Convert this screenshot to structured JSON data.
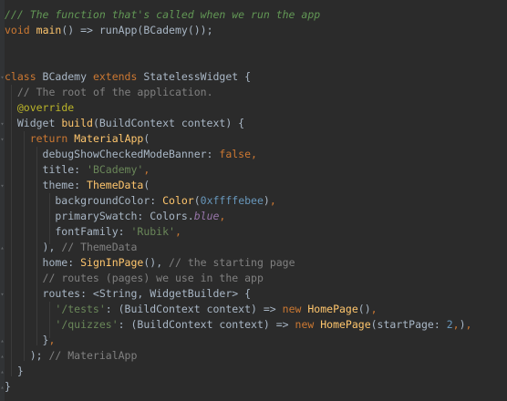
{
  "editor": {
    "lines": [
      {
        "tokens": [
          {
            "t": "/// The function that's called when we run the app",
            "c": "c"
          }
        ]
      },
      {
        "tokens": [
          {
            "t": "void",
            "c": "k"
          },
          {
            "t": " ",
            "c": "p"
          },
          {
            "t": "main",
            "c": "fn"
          },
          {
            "t": "() => runApp(BCademy());",
            "c": "p"
          }
        ]
      },
      {
        "tokens": []
      },
      {
        "tokens": []
      },
      {
        "tokens": [
          {
            "t": "class",
            "c": "k"
          },
          {
            "t": " BCademy ",
            "c": "p"
          },
          {
            "t": "extends",
            "c": "k"
          },
          {
            "t": " StatelessWidget {",
            "c": "p"
          }
        ]
      },
      {
        "tokens": [
          {
            "t": "  ",
            "c": "p"
          },
          {
            "t": "// The root of the application.",
            "c": "cm"
          }
        ]
      },
      {
        "tokens": [
          {
            "t": "  ",
            "c": "p"
          },
          {
            "t": "@override",
            "c": "an"
          }
        ]
      },
      {
        "tokens": [
          {
            "t": "  Widget ",
            "c": "p"
          },
          {
            "t": "build",
            "c": "fn"
          },
          {
            "t": "(BuildContext context) {",
            "c": "p"
          }
        ]
      },
      {
        "tokens": [
          {
            "t": "    ",
            "c": "p"
          },
          {
            "t": "return",
            "c": "k"
          },
          {
            "t": " ",
            "c": "p"
          },
          {
            "t": "MaterialApp",
            "c": "fn"
          },
          {
            "t": "(",
            "c": "p"
          }
        ]
      },
      {
        "tokens": [
          {
            "t": "      debugShowCheckedModeBanner: ",
            "c": "p"
          },
          {
            "t": "false",
            "c": "k"
          },
          {
            "t": ",",
            "c": "k"
          }
        ]
      },
      {
        "tokens": [
          {
            "t": "      title: ",
            "c": "p"
          },
          {
            "t": "'BCademy'",
            "c": "s"
          },
          {
            "t": ",",
            "c": "k"
          }
        ]
      },
      {
        "tokens": [
          {
            "t": "      theme: ",
            "c": "p"
          },
          {
            "t": "ThemeData",
            "c": "fn"
          },
          {
            "t": "(",
            "c": "p"
          }
        ]
      },
      {
        "tokens": [
          {
            "t": "        backgroundColor: ",
            "c": "p"
          },
          {
            "t": "Color",
            "c": "fn"
          },
          {
            "t": "(",
            "c": "p"
          },
          {
            "t": "0xffffebee",
            "c": "n"
          },
          {
            "t": ")",
            "c": "p"
          },
          {
            "t": ",",
            "c": "k"
          }
        ]
      },
      {
        "tokens": [
          {
            "t": "        primarySwatch: Colors.",
            "c": "p"
          },
          {
            "t": "blue",
            "c": "it"
          },
          {
            "t": ",",
            "c": "k"
          }
        ]
      },
      {
        "tokens": [
          {
            "t": "        fontFamily: ",
            "c": "p"
          },
          {
            "t": "'Rubik'",
            "c": "s"
          },
          {
            "t": ",",
            "c": "k"
          }
        ]
      },
      {
        "tokens": [
          {
            "t": "      ), ",
            "c": "p"
          },
          {
            "t": "// ThemeData",
            "c": "cm"
          }
        ]
      },
      {
        "tokens": [
          {
            "t": "      home: ",
            "c": "p"
          },
          {
            "t": "SignInPage",
            "c": "fn"
          },
          {
            "t": "(), ",
            "c": "p"
          },
          {
            "t": "// the starting page",
            "c": "cm"
          }
        ]
      },
      {
        "tokens": [
          {
            "t": "      ",
            "c": "p"
          },
          {
            "t": "// routes (pages) we use in the app",
            "c": "cm"
          }
        ]
      },
      {
        "tokens": [
          {
            "t": "      routes: <String, WidgetBuilder> {",
            "c": "p"
          }
        ]
      },
      {
        "tokens": [
          {
            "t": "        ",
            "c": "p"
          },
          {
            "t": "'/tests'",
            "c": "s"
          },
          {
            "t": ": (BuildContext context) => ",
            "c": "p"
          },
          {
            "t": "new",
            "c": "k"
          },
          {
            "t": " ",
            "c": "p"
          },
          {
            "t": "HomePage",
            "c": "fn"
          },
          {
            "t": "()",
            "c": "p"
          },
          {
            "t": ",",
            "c": "k"
          }
        ]
      },
      {
        "tokens": [
          {
            "t": "        ",
            "c": "p"
          },
          {
            "t": "'/quizzes'",
            "c": "s"
          },
          {
            "t": ": (BuildContext context) => ",
            "c": "p"
          },
          {
            "t": "new",
            "c": "k"
          },
          {
            "t": " ",
            "c": "p"
          },
          {
            "t": "HomePage",
            "c": "fn"
          },
          {
            "t": "(startPage: ",
            "c": "p"
          },
          {
            "t": "2",
            "c": "n"
          },
          {
            "t": ",",
            "c": "k"
          },
          {
            "t": ")",
            "c": "p"
          },
          {
            "t": ",",
            "c": "k"
          }
        ]
      },
      {
        "tokens": [
          {
            "t": "      }",
            "c": "p"
          },
          {
            "t": ",",
            "c": "k"
          }
        ]
      },
      {
        "tokens": [
          {
            "t": "    ); ",
            "c": "p"
          },
          {
            "t": "// MaterialApp",
            "c": "cm"
          }
        ]
      },
      {
        "tokens": [
          {
            "t": "  }",
            "c": "p"
          }
        ]
      },
      {
        "tokens": [
          {
            "t": "}",
            "c": "p"
          }
        ]
      }
    ]
  }
}
